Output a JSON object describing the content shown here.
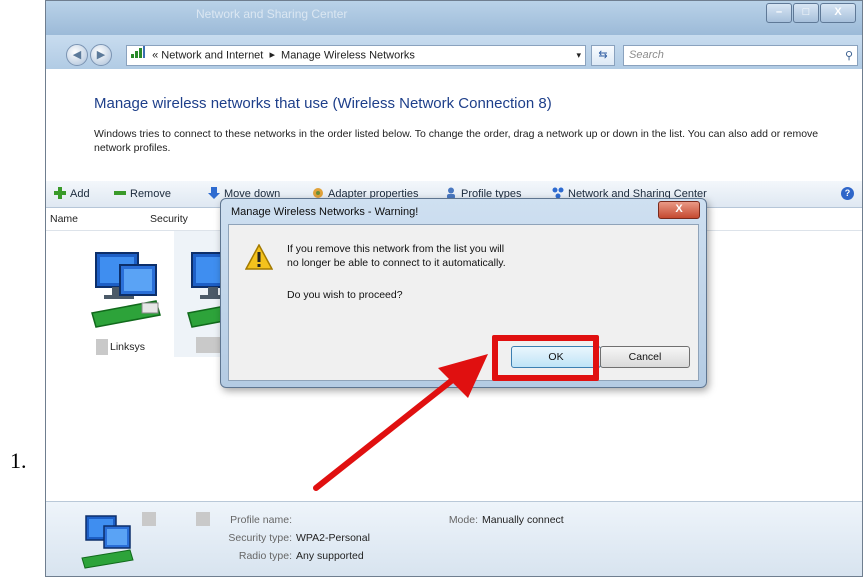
{
  "step_number": "1.",
  "window": {
    "title": "Network and Sharing Center",
    "controls": {
      "minimize": "–",
      "maximize": "□",
      "close": "X"
    }
  },
  "address_bar": {
    "prefix": "«",
    "path_part1": "Network and Internet",
    "separator": "▸",
    "path_part2": "Manage Wireless Networks",
    "dropdown": "▾"
  },
  "search": {
    "placeholder": "Search"
  },
  "header": {
    "title": "Manage wireless networks that use (Wireless Network Connection 8)",
    "description": "Windows tries to connect to these networks in the order listed below. To change the order, drag a network up or down in the list. You can also add or remove network profiles."
  },
  "toolbar": {
    "add": "Add",
    "remove": "Remove",
    "move_down": "Move down",
    "adapter_properties": "Adapter properties",
    "profile_types": "Profile types",
    "network_center": "Network and Sharing Center",
    "help": "?"
  },
  "columns": {
    "name": "Name",
    "security": "Security"
  },
  "networks": [
    {
      "label": "Linksys"
    },
    {
      "label": ""
    }
  ],
  "details": {
    "profile_name_label": "Profile name:",
    "profile_name_value": "",
    "mode_label": "Mode:",
    "mode_value": "Manually connect",
    "security_type_label": "Security type:",
    "security_type_value": "WPA2-Personal",
    "radio_type_label": "Radio type:",
    "radio_type_value": "Any supported"
  },
  "dialog": {
    "title": "Manage Wireless Networks - Warning!",
    "close": "X",
    "message_line1": "If you remove this network from the list you will",
    "message_line2": "no longer be able to connect to it automatically.",
    "question": "Do you wish to proceed?",
    "ok": "OK",
    "cancel": "Cancel"
  },
  "colors": {
    "heading": "#1e3f8a",
    "highlight": "#e01010",
    "arrow": "#e01010"
  }
}
